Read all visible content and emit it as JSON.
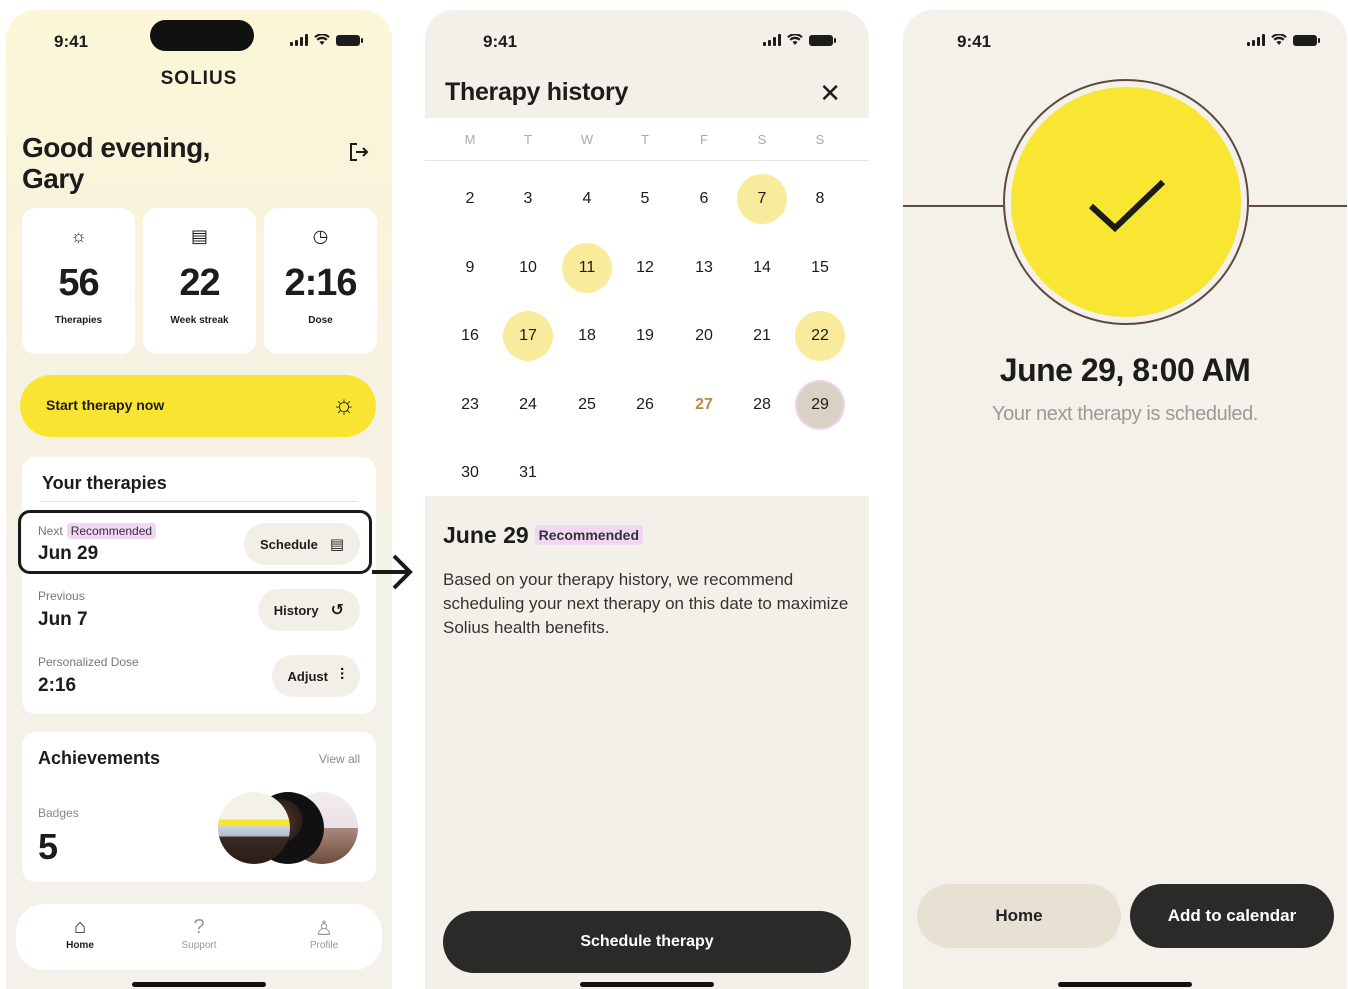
{
  "status": {
    "time": "9:41"
  },
  "home": {
    "brand": "SOLIUS",
    "greeting": "Good evening,",
    "user_name": "Gary",
    "stats": [
      {
        "value": "56",
        "label": "Therapies",
        "icon": "sun-icon"
      },
      {
        "value": "22",
        "label": "Week streak",
        "icon": "calendar-icon"
      },
      {
        "value": "2:16",
        "label": "Dose",
        "icon": "clock-icon"
      }
    ],
    "start_button": "Start therapy now",
    "therapies": {
      "title": "Your therapies",
      "next_label": "Next",
      "recommended": "Recommended",
      "next_value": "Jun 29",
      "schedule_button": "Schedule",
      "previous_label": "Previous",
      "previous_value": "Jun 7",
      "history_button": "History",
      "dose_label": "Personalized Dose",
      "dose_value": "2:16",
      "adjust_button": "Adjust"
    },
    "achievements": {
      "title": "Achievements",
      "view_all": "View all",
      "badges_label": "Badges",
      "badges_count": "5"
    },
    "tabs": [
      "Home",
      "Support",
      "Profile"
    ]
  },
  "history": {
    "title": "Therapy history",
    "weekdays": [
      "M",
      "T",
      "W",
      "T",
      "F",
      "S",
      "S"
    ],
    "days": [
      [
        "2",
        "3",
        "4",
        "5",
        "6",
        "7",
        "8"
      ],
      [
        "9",
        "10",
        "11",
        "12",
        "13",
        "14",
        "15"
      ],
      [
        "16",
        "17",
        "18",
        "19",
        "20",
        "21",
        "22"
      ],
      [
        "23",
        "24",
        "25",
        "26",
        "27",
        "28",
        "29"
      ],
      [
        "30",
        "31"
      ]
    ],
    "highlighted_days": [
      "7",
      "11",
      "17",
      "22"
    ],
    "today": "27",
    "selected_day": "29",
    "selected_date": "June 29",
    "recommended": "Recommended",
    "description": "Based on your therapy history, we recommend scheduling your next therapy on this date to maximize Solius health benefits.",
    "button": "Schedule therapy"
  },
  "confirm": {
    "datetime": "June 29, 8:00 AM",
    "subtitle": "Your next therapy is scheduled.",
    "home_button": "Home",
    "calendar_button": "Add to calendar"
  },
  "colors": {
    "accent_yellow": "#f9e432",
    "dark": "#2a2a28",
    "recommended_bg": "#f2d7f4",
    "today": "#b88a4a"
  }
}
